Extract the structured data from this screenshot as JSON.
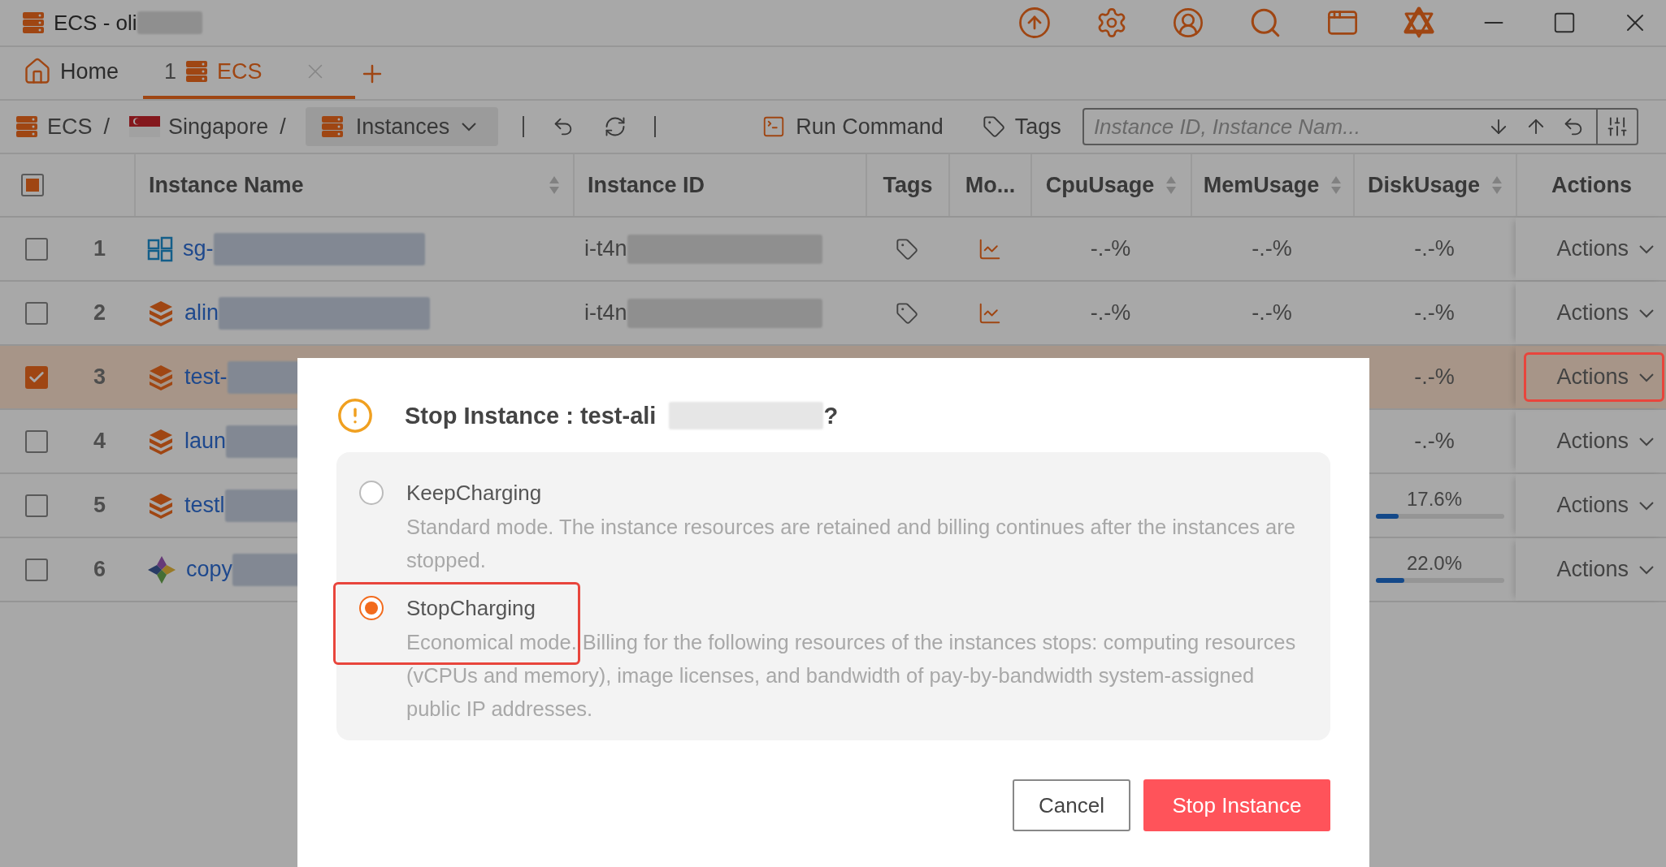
{
  "window": {
    "title": "ECS - oli"
  },
  "tabs": [
    {
      "kind": "home",
      "label": "Home",
      "selected": false
    },
    {
      "kind": "service",
      "count": "1",
      "label": "ECS",
      "selected": true
    }
  ],
  "breadcrumb": [
    {
      "kind": "service",
      "label": "ECS",
      "separator": "/"
    },
    {
      "kind": "region",
      "label": "Singapore",
      "separator": "/"
    }
  ],
  "view_dropdown": {
    "label": "Instances"
  },
  "toolbar": {
    "run_command": "Run Command",
    "tags": "Tags",
    "search": {
      "placeholder": "Instance ID, Instance Nam..."
    }
  },
  "table": {
    "header_checkbox": {
      "indeterminate": true
    },
    "columns": [
      {
        "label": "Instance Name",
        "sortable": true
      },
      {
        "label": "Instance ID",
        "sortable": false
      },
      {
        "label": "Tags",
        "sortable": false
      },
      {
        "label": "Mo...",
        "sortable": false
      },
      {
        "label": "CpuUsage",
        "sortable": true
      },
      {
        "label": "MemUsage",
        "sortable": true
      },
      {
        "label": "DiskUsage",
        "sortable": true
      },
      {
        "label": "Actions",
        "sortable": false
      }
    ],
    "rows": [
      {
        "index": "1",
        "selected": false,
        "kind": "grid",
        "name": "sg-",
        "instance_id": "i-t4n",
        "cpu": "-.-%",
        "mem": "-.-%",
        "disk": {
          "text": "-.-%"
        },
        "action": "Actions",
        "highlighted": false
      },
      {
        "index": "2",
        "selected": false,
        "kind": "box",
        "name": "alin",
        "instance_id": "i-t4n",
        "cpu": "-.-%",
        "mem": "-.-%",
        "disk": {
          "text": "-.-%"
        },
        "action": "Actions",
        "highlighted": false
      },
      {
        "index": "3",
        "selected": true,
        "kind": "box",
        "name": "test-",
        "disk": {
          "text": "-.-%"
        },
        "action": "Actions",
        "highlighted": true
      },
      {
        "index": "4",
        "selected": false,
        "kind": "box",
        "name": "laun",
        "disk": {
          "text": "-.-%"
        },
        "action": "Actions",
        "highlighted": false
      },
      {
        "index": "5",
        "selected": false,
        "kind": "box",
        "name": "testl",
        "disk": {
          "text": "17.6%",
          "level": 0.176
        },
        "action": "Actions",
        "highlighted": false
      },
      {
        "index": "6",
        "selected": false,
        "kind": "pinwheel",
        "name": "copy",
        "disk": {
          "text": "22.0%",
          "level": 0.22
        },
        "action": "Actions",
        "highlighted": false
      }
    ]
  },
  "dialog": {
    "title": "Stop Instance : test-ali",
    "title_end": "?",
    "options": [
      {
        "label": "KeepCharging",
        "description": "Standard mode. The instance resources are retained and billing continues after the instances are stopped.",
        "selected": false,
        "highlighted": false
      },
      {
        "label": "StopCharging",
        "description": "Economical mode. Billing for the following resources of the instances stops: computing resources (vCPUs and memory), image licenses, and bandwidth of pay-by-bandwidth system-assigned public IP addresses.",
        "selected": true,
        "highlighted": true
      }
    ],
    "buttons": [
      {
        "kind": "secondary",
        "label": "Cancel"
      },
      {
        "kind": "primary",
        "label": "Stop Instance"
      }
    ]
  }
}
